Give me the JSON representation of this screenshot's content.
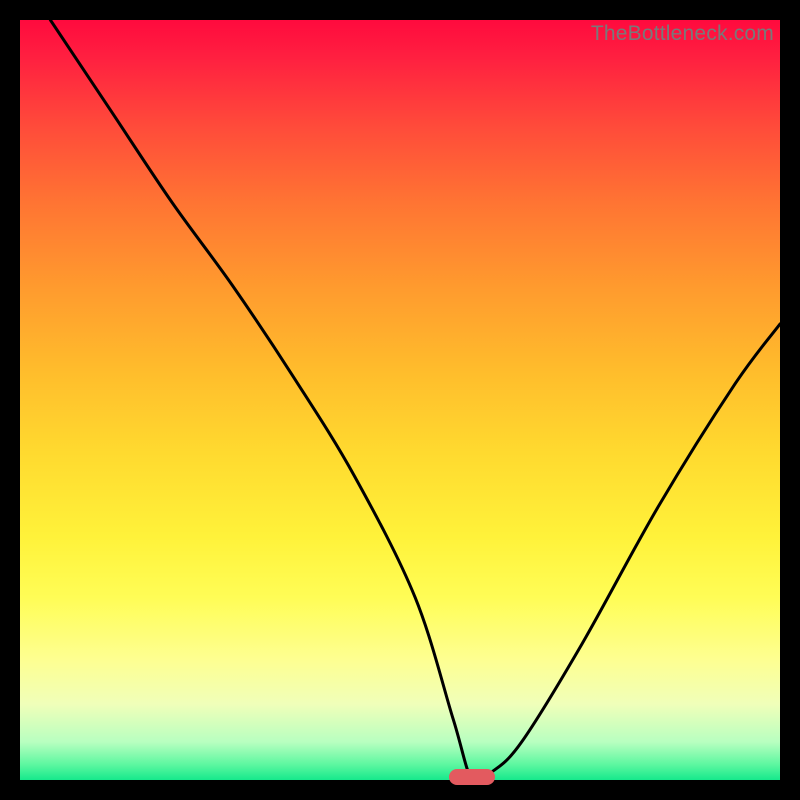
{
  "watermark": "TheBottleneck.com",
  "chart_data": {
    "type": "line",
    "title": "",
    "xlabel": "",
    "ylabel": "",
    "xlim": [
      0,
      100
    ],
    "ylim": [
      0,
      100
    ],
    "grid": false,
    "legend": false,
    "series": [
      {
        "name": "bottleneck-curve",
        "x": [
          4,
          12,
          20,
          28,
          36,
          44,
          52,
          57,
          59.5,
          62,
          66,
          74,
          84,
          94,
          100
        ],
        "y": [
          100,
          88,
          76,
          65,
          53,
          40,
          24,
          8,
          0,
          1,
          5,
          18,
          36,
          52,
          60
        ]
      }
    ],
    "marker": {
      "x": 59.5,
      "y": 0,
      "color": "#e35a5f"
    },
    "gradient_stops": [
      {
        "pos": 0,
        "color": "#ff0a3e"
      },
      {
        "pos": 14,
        "color": "#ff4b3a"
      },
      {
        "pos": 35,
        "color": "#ff9a2e"
      },
      {
        "pos": 57,
        "color": "#ffda2f"
      },
      {
        "pos": 76,
        "color": "#fffd56"
      },
      {
        "pos": 90,
        "color": "#f0ffb9"
      },
      {
        "pos": 100,
        "color": "#16e98c"
      }
    ]
  }
}
